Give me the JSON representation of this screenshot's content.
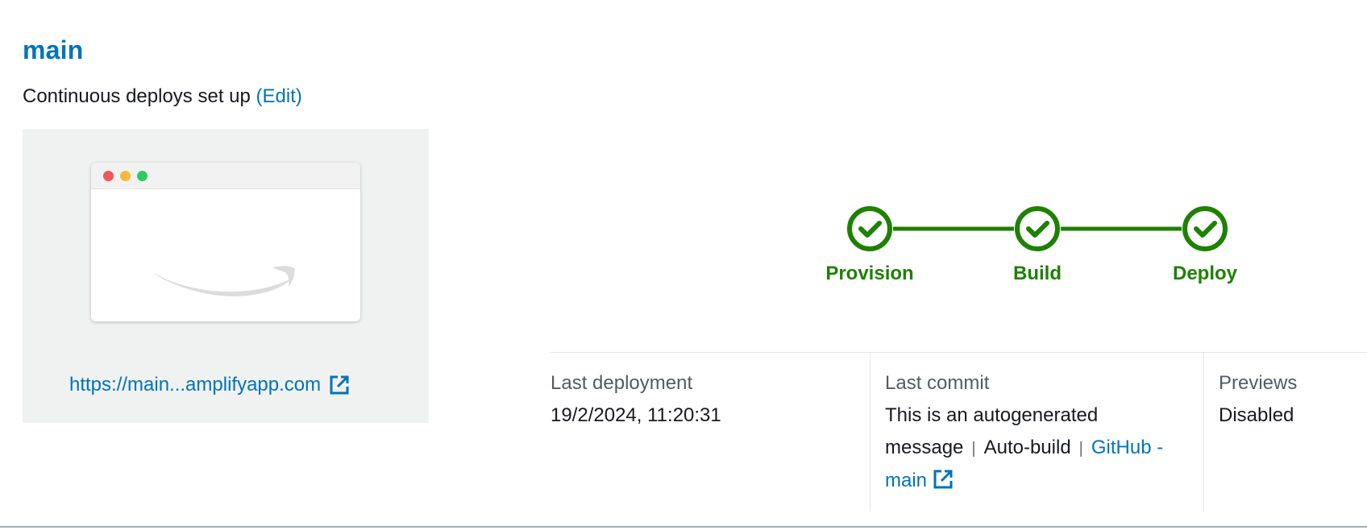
{
  "branch": {
    "title": "main",
    "subtitle": "Continuous deploys set up",
    "edit_label": "(Edit)"
  },
  "preview": {
    "url_label": "https://main...amplifyapp.com"
  },
  "pipeline": {
    "stages": [
      {
        "label": "Provision",
        "status": "succeeded"
      },
      {
        "label": "Build",
        "status": "succeeded"
      },
      {
        "label": "Deploy",
        "status": "succeeded"
      }
    ],
    "color": "#1d8102"
  },
  "info": {
    "last_deployment": {
      "label": "Last deployment",
      "value": "19/2/2024, 11:20:31"
    },
    "last_commit": {
      "label": "Last commit",
      "message": "This is an autogenerated message",
      "separator": "|",
      "trigger": "Auto-build",
      "repo_link": "GitHub - main"
    },
    "previews": {
      "label": "Previews",
      "value": "Disabled"
    }
  },
  "colors": {
    "link": "#0073bb",
    "success": "#1d8102"
  }
}
